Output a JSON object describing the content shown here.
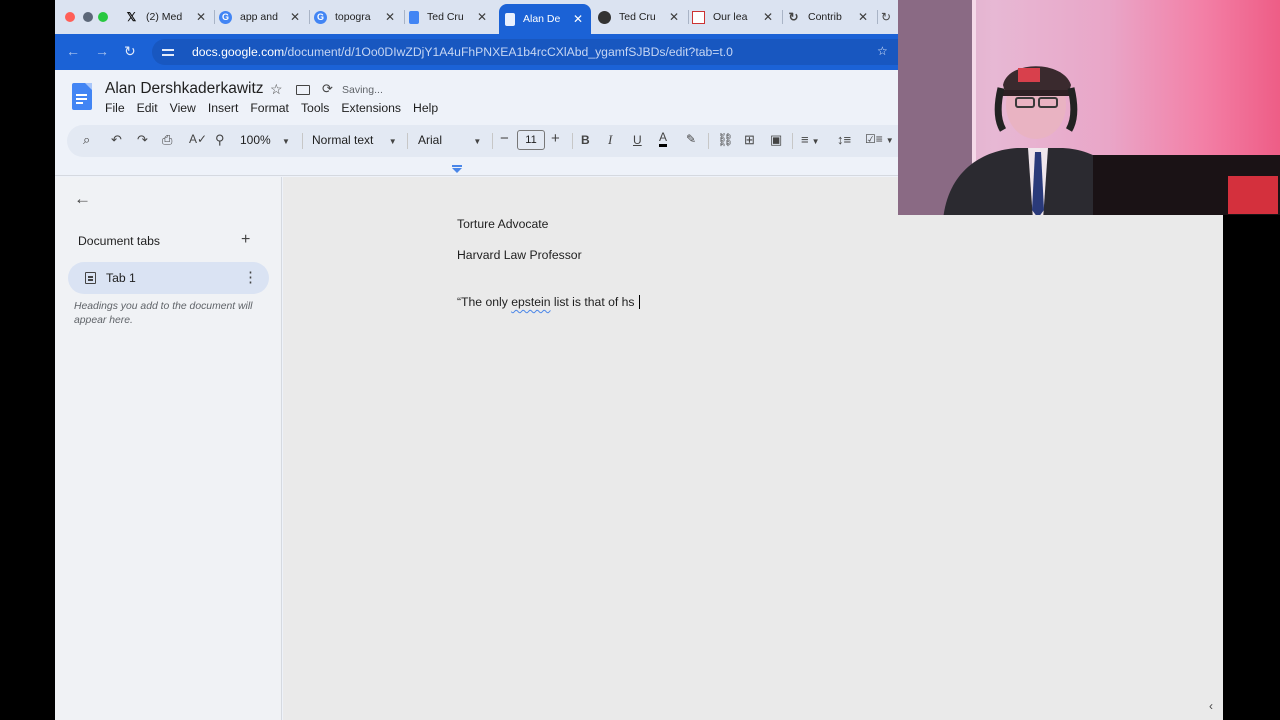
{
  "window": {
    "tabs": [
      {
        "title": "(2) Med",
        "icon": "x-logo-icon"
      },
      {
        "title": "app and",
        "icon": "google-icon"
      },
      {
        "title": "topogra",
        "icon": "google-icon"
      },
      {
        "title": "Ted Cru",
        "icon": "docs-icon"
      },
      {
        "title": "Alan De",
        "icon": "docs-icon",
        "active": true
      },
      {
        "title": "Ted Cru",
        "icon": "site-icon"
      },
      {
        "title": "Our lea",
        "icon": "site-icon"
      },
      {
        "title": "Contrib",
        "icon": "refresh-site-icon"
      }
    ],
    "url_host": "docs.google.com",
    "url_path": "/document/d/1Oo0DIwZDjY1A4uFhPNXEA1b4rcCXlAbd_ygamfSJBDs/edit?tab=t.0"
  },
  "docs": {
    "title": "Alan Dershkaderkawitz",
    "saving": "Saving...",
    "menu": [
      "File",
      "Edit",
      "View",
      "Insert",
      "Format",
      "Tools",
      "Extensions",
      "Help"
    ],
    "toolbar": {
      "zoom": "100%",
      "style": "Normal text",
      "font": "Arial",
      "font_size": "11"
    },
    "sidebar": {
      "heading": "Document tabs",
      "tab_label": "Tab 1",
      "hint": "Headings you add to the document will appear here."
    },
    "body": {
      "line1": "Torture Advocate",
      "line2": "Harvard Law Professor",
      "line3_prefix": "“The only ",
      "line3_spell": "epstein",
      "line3_suffix": " list is that of hs "
    }
  },
  "colors": {
    "accent": "#1b62d6",
    "docs_blue": "#4285f4"
  }
}
